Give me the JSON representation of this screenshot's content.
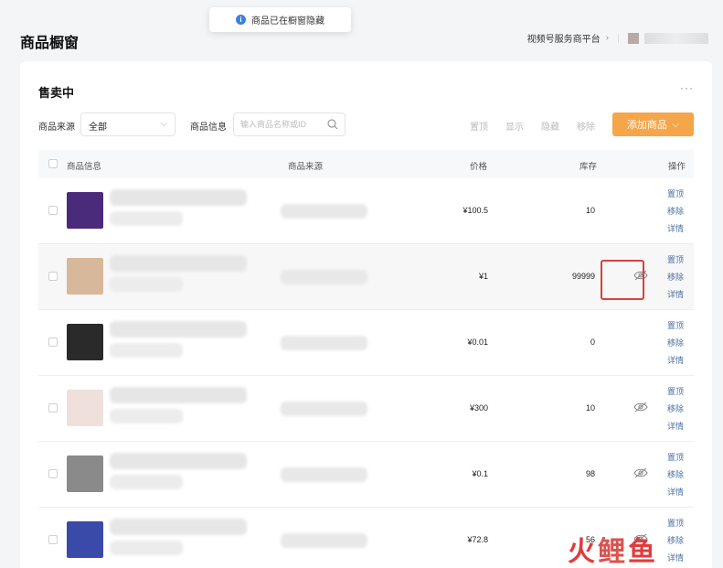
{
  "toast": {
    "icon": "info-icon",
    "text": "商品已在橱窗隐藏"
  },
  "header": {
    "title": "商品橱窗",
    "platform_link": "视频号服务商平台"
  },
  "card": {
    "title": "售卖中",
    "more": "···",
    "filters": {
      "source_label": "商品来源",
      "source_value": "全部",
      "info_label": "商品信息",
      "search_placeholder": "输入商品名称或ID"
    },
    "actions": {
      "pin": "置顶",
      "show": "显示",
      "hide": "隐藏",
      "remove": "移除"
    },
    "add_button": "添加商品"
  },
  "table": {
    "columns": {
      "info": "商品信息",
      "source": "商品来源",
      "price": "价格",
      "stock": "库存",
      "ops": "操作"
    },
    "rows": [
      {
        "price": "¥100.5",
        "stock": "10",
        "hidden": false,
        "thumb_color": "#4a2a7a",
        "op_pin": "置顶",
        "op_remove": "移除",
        "op_detail": "详情"
      },
      {
        "price": "¥1",
        "stock": "99999",
        "hidden": true,
        "thumb_color": "#d8b89a",
        "op_pin": "置顶",
        "op_remove": "移除",
        "op_detail": "详情"
      },
      {
        "price": "¥0.01",
        "stock": "0",
        "hidden": false,
        "thumb_color": "#2a2a2a",
        "op_pin": "置顶",
        "op_remove": "移除",
        "op_detail": "详情"
      },
      {
        "price": "¥300",
        "stock": "10",
        "hidden": true,
        "thumb_color": "#efe0dc",
        "op_pin": "置顶",
        "op_remove": "移除",
        "op_detail": "详情"
      },
      {
        "price": "¥0.1",
        "stock": "98",
        "hidden": true,
        "thumb_color": "#8a8a8a",
        "op_pin": "置顶",
        "op_remove": "移除",
        "op_detail": "详情"
      },
      {
        "price": "¥72.8",
        "stock": "56",
        "hidden": true,
        "thumb_color": "#3a4aa8",
        "op_pin": "置顶",
        "op_remove": "移除",
        "op_detail": "详情"
      }
    ]
  },
  "watermark": {
    "c1": "火",
    "c2": "鲤",
    "c3": "鱼"
  },
  "colors": {
    "accent": "#f5a54a",
    "link": "#4a6fa5",
    "highlight_box": "#d9413a",
    "info": "#3d7fe0"
  }
}
